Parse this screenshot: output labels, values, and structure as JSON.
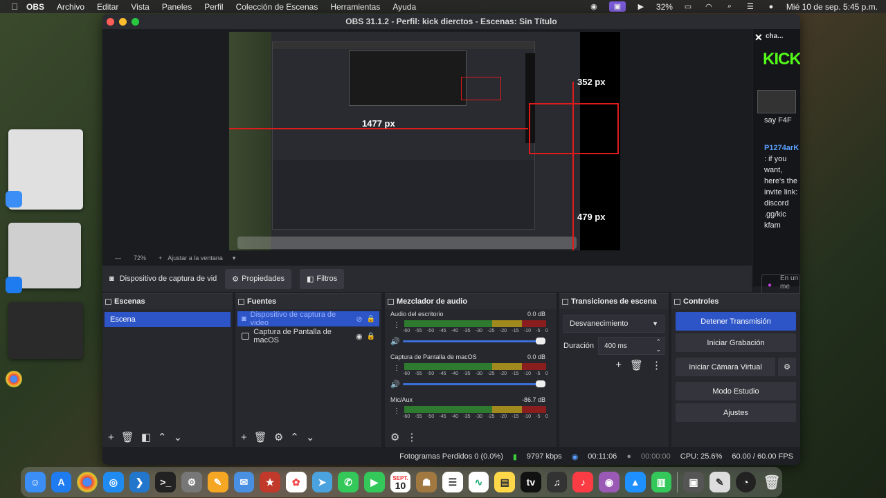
{
  "menubar": {
    "app": "OBS",
    "items": [
      "Archivo",
      "Editar",
      "Vista",
      "Paneles",
      "Perfil",
      "Colección de Escenas",
      "Herramientas",
      "Ayuda"
    ],
    "battery": "32%",
    "datetime": "Mié 10 de sep.  5:45 p.m."
  },
  "window": {
    "title": "OBS 31.1.2 - Perfil: kick dierctos - Escenas: Sin Título"
  },
  "preview": {
    "label_width": "1477 px",
    "label_top": "352 px",
    "label_bottom": "479 px",
    "zoom": "72%",
    "zoom_plus": "+",
    "zoom_minus": "—",
    "fit": "Ajustar a la ventana"
  },
  "chat": {
    "title": "cha...",
    "brand": "KICK",
    "msg1": "say F4F",
    "user": "P1274arK",
    "msg2": ": if you want, here's the invite link: discord .gg/kic kfam",
    "mic_hint": "En un me"
  },
  "sourcebar": {
    "source": "Dispositivo de captura de vid",
    "properties": "Propiedades",
    "filters": "Filtros"
  },
  "scenes": {
    "title": "Escenas",
    "items": [
      "Escena"
    ]
  },
  "sources": {
    "title": "Fuentes",
    "items": [
      "Dispositivo de captura de video",
      "Captura de Pantalla de macOS"
    ]
  },
  "mixer": {
    "title": "Mezclador de audio",
    "ticks": [
      "-60",
      "-55",
      "-50",
      "-45",
      "-40",
      "-35",
      "-30",
      "-25",
      "-20",
      "-15",
      "-10",
      "-5",
      "0"
    ],
    "channels": [
      {
        "name": "Audio del escritorio",
        "db": "0.0 dB"
      },
      {
        "name": "Captura de Pantalla de macOS",
        "db": "0.0 dB"
      },
      {
        "name": "Mic/Aux",
        "db": "-86.7 dB"
      }
    ]
  },
  "transitions": {
    "title": "Transiciones de escena",
    "selected": "Desvanecimiento",
    "duration_label": "Duración",
    "duration_value": "400 ms"
  },
  "controls": {
    "title": "Controles",
    "stop_stream": "Detener Transmisión",
    "start_recording": "Iniciar Grabación",
    "start_virtual_cam": "Iniciar Cámara Virtual",
    "studio_mode": "Modo Estudio",
    "settings": "Ajustes"
  },
  "status": {
    "dropped_frames": "Fotogramas Perdidos 0 (0.0%)",
    "bitrate": "9797 kbps",
    "stream_time": "00:11:06",
    "rec_time": "00:00:00",
    "cpu": "CPU: 25.6%",
    "fps": "60.00 / 60.00 FPS"
  },
  "dock": {
    "calendar_month": "SEPT.",
    "calendar_day": "10"
  },
  "colors": {
    "accent": "#2d55c8",
    "kick_green": "#53fc18",
    "red_guide": "#e01b1b"
  }
}
